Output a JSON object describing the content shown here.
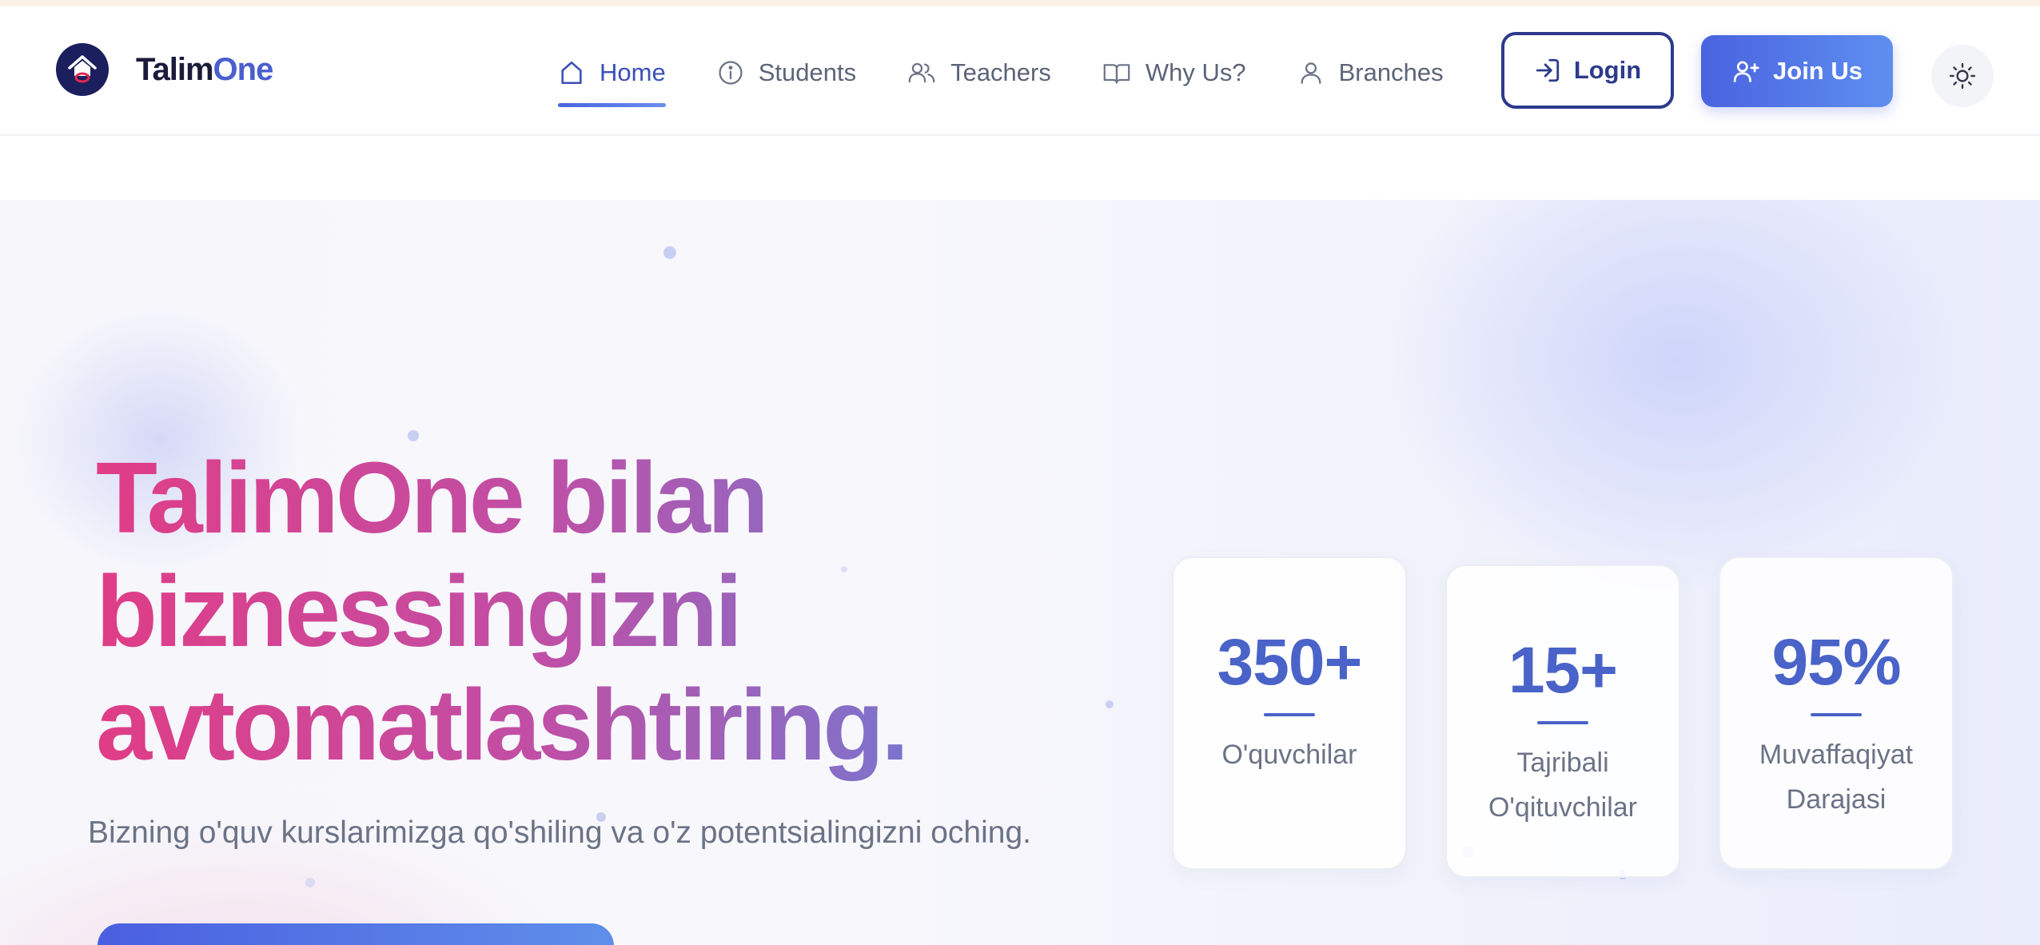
{
  "header": {
    "brand": {
      "name_part1": "Talim",
      "name_part2": "One"
    },
    "nav": [
      {
        "label": "Home",
        "icon": "home-icon",
        "active": true
      },
      {
        "label": "Students",
        "icon": "info-icon"
      },
      {
        "label": "Teachers",
        "icon": "users-icon"
      },
      {
        "label": "Why Us?",
        "icon": "book-open-icon"
      },
      {
        "label": "Branches",
        "icon": "user-icon"
      }
    ],
    "login_label": "Login",
    "join_label": "Join Us",
    "theme_toggle_icon": "sun-icon"
  },
  "hero": {
    "headline_line1": "TalimOne bilan",
    "headline_line2": "biznessingizni",
    "headline_line3": "avtomatlashtiring.",
    "subtext": "Bizning o'quv kurslarimizga qo'shiling va o'z potentsialingizni oching.",
    "stats": [
      {
        "value": "350+",
        "label": "O'quvchilar"
      },
      {
        "value": "15+",
        "label": "Tajribali O'qituvchilar"
      },
      {
        "value": "95%",
        "label": "Muvaffaqiyat Darajasi"
      }
    ]
  },
  "colors": {
    "primary": "#4a63e0",
    "brand_dark": "#1b1f5e",
    "headline_start": "#e03d86",
    "headline_end": "#5b86e0"
  }
}
